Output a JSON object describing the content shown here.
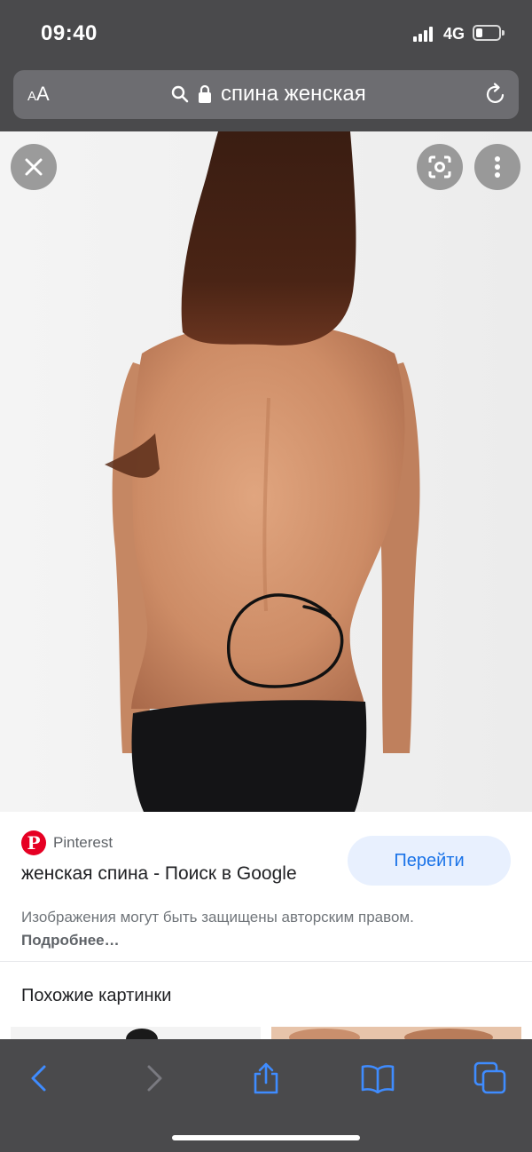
{
  "status_bar": {
    "time": "09:40",
    "network": "4G",
    "signal_bars": 4,
    "battery_level": 0.3
  },
  "address_bar": {
    "text_size_label_small": "A",
    "text_size_label_large": "A",
    "url": "спина женская",
    "icons": [
      "search-icon",
      "lock-icon",
      "reload-icon"
    ]
  },
  "viewer": {
    "close_icon": "close-icon",
    "lens_icon": "google-lens-icon",
    "more_icon": "more-vertical-icon"
  },
  "result": {
    "source_logo_letter": "P",
    "source_name": "Pinterest",
    "title": "женская спина - Поиск в Google",
    "visit_label": "Перейти",
    "copyright_text": "Изображения могут быть защищены авторским правом.",
    "copyright_link": "Подробнее…"
  },
  "similar": {
    "title": "Похожие картинки"
  },
  "toolbar": {
    "items": [
      "back-icon",
      "forward-icon",
      "share-icon",
      "bookmarks-icon",
      "tabs-icon"
    ]
  },
  "colors": {
    "chrome": "#4a4a4c",
    "address_bar": "#6d6d71",
    "accent_blue": "#1a73e8",
    "toolbar_icon_blue": "#3f8cff",
    "pinterest_red": "#e60023"
  }
}
